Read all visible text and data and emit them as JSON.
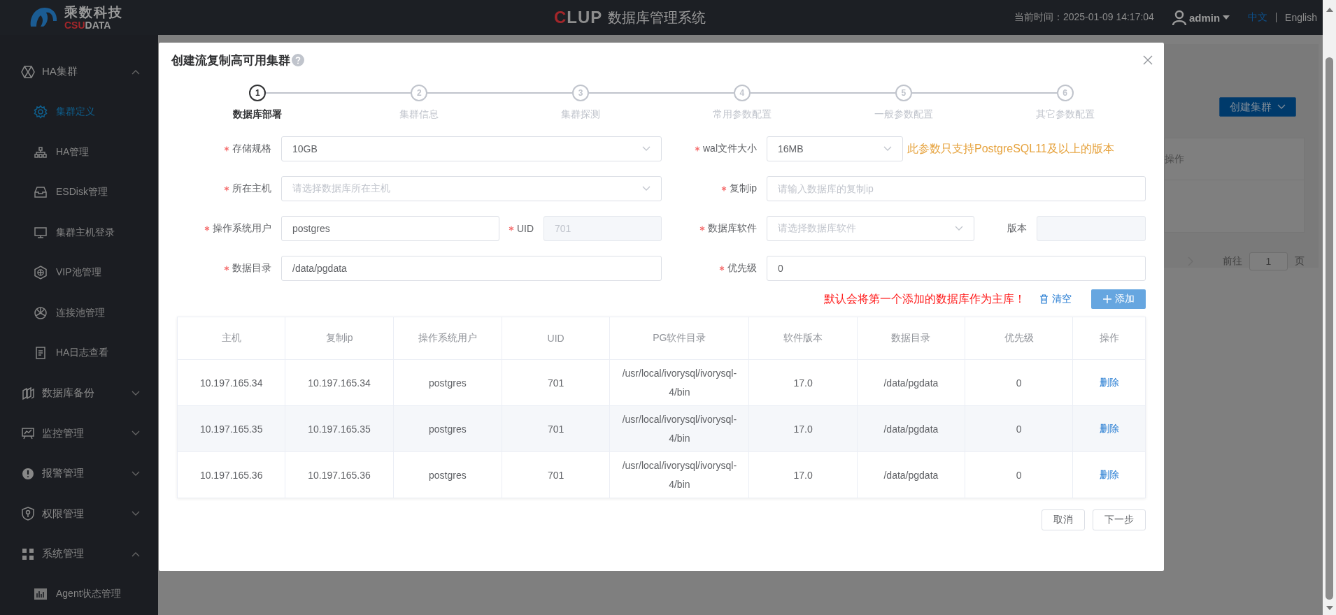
{
  "header": {
    "brand_cn": "乘数科技",
    "brand_mark_a": "CSU",
    "brand_mark_b": "DATA",
    "product_a": "C",
    "product_b": "LUP",
    "title": "数据库管理系统",
    "time": "当前时间：2025-01-09 14:17:04",
    "user": "admin",
    "languages": [
      {
        "label": "中文",
        "selected": true
      },
      {
        "label": "English",
        "selected": false
      }
    ]
  },
  "sidebar": {
    "items": [
      {
        "label": "HA集群",
        "expanded": true,
        "children": [
          {
            "label": "集群定义",
            "selected": true
          },
          {
            "label": "HA管理",
            "selected": false
          },
          {
            "label": "ESDisk管理",
            "selected": false
          },
          {
            "label": "集群主机登录",
            "selected": false
          },
          {
            "label": "VIP池管理",
            "selected": false
          },
          {
            "label": "连接池管理",
            "selected": false
          },
          {
            "label": "HA日志查看",
            "selected": false
          }
        ]
      },
      {
        "label": "数据库备份",
        "expanded": false
      },
      {
        "label": "监控管理",
        "expanded": false
      },
      {
        "label": "报警管理",
        "expanded": false
      },
      {
        "label": "权限管理",
        "expanded": false
      },
      {
        "label": "系统管理",
        "expanded": true,
        "children": [
          {
            "label": "Agent状态管理",
            "selected": false
          }
        ]
      }
    ]
  },
  "background_page": {
    "create_button": "创建集群",
    "table_header": "操作",
    "pagination": {
      "goto": "前往",
      "page": "1",
      "suffix": "页"
    }
  },
  "dialog": {
    "title": "创建流复制高可用集群",
    "steps": [
      {
        "number": "1",
        "label": "数据库部署",
        "selected": true
      },
      {
        "number": "2",
        "label": "集群信息",
        "selected": false
      },
      {
        "number": "3",
        "label": "集群探测",
        "selected": false
      },
      {
        "number": "4",
        "label": "常用参数配置",
        "selected": false
      },
      {
        "number": "5",
        "label": "一般参数配置",
        "selected": false
      },
      {
        "number": "6",
        "label": "其它参数配置",
        "selected": false
      }
    ],
    "form_rows": [
      {
        "left": [
          {
            "label": "存储规格",
            "required": true,
            "kind": "select",
            "value": "10GB"
          }
        ],
        "right": [
          {
            "label": "wal文件大小",
            "required": true,
            "kind": "select",
            "value": "16MB"
          }
        ],
        "note": "此参数只支持PostgreSQL11及以上的版本"
      },
      {
        "left": [
          {
            "label": "所在主机",
            "required": true,
            "kind": "select",
            "placeholder": "请选择数据库所在主机"
          }
        ],
        "right": [
          {
            "label": "复制ip",
            "required": true,
            "kind": "input",
            "placeholder": "请输入数据库的复制ip"
          }
        ]
      },
      {
        "left": [
          {
            "label": "操作系统用户",
            "required": true,
            "kind": "input",
            "value": "postgres"
          },
          {
            "label": "UID",
            "required": true,
            "kind": "input",
            "value": "701",
            "disabled": true
          }
        ],
        "right": [
          {
            "label": "数据库软件",
            "required": true,
            "kind": "select",
            "placeholder": "请选择数据库软件"
          },
          {
            "label": "版本",
            "required": false,
            "kind": "input",
            "disabled": true
          }
        ]
      },
      {
        "left": [
          {
            "label": "数据目录",
            "required": true,
            "kind": "input",
            "value": "/data/pgdata"
          }
        ],
        "right": [
          {
            "label": "优先级",
            "required": true,
            "kind": "input",
            "value": "0"
          }
        ]
      }
    ],
    "warning": "默认会将第一个添加的数据库作为主库！",
    "clear_link": "清空",
    "add_button": "添加",
    "table": {
      "columns": [
        "主机",
        "复制ip",
        "操作系统用户",
        "UID",
        "PG软件目录",
        "软件版本",
        "数据目录",
        "优先级",
        "操作"
      ],
      "rows": [
        {
          "cells": [
            "10.197.165.34",
            "10.197.165.34",
            "postgres",
            "701",
            "/usr/local/ivorysql/ivorysql-4/bin",
            "17.0",
            "/data/pgdata",
            "0"
          ],
          "action": "删除"
        },
        {
          "cells": [
            "10.197.165.35",
            "10.197.165.35",
            "postgres",
            "701",
            "/usr/local/ivorysql/ivorysql-4/bin",
            "17.0",
            "/data/pgdata",
            "0"
          ],
          "action": "删除"
        },
        {
          "cells": [
            "10.197.165.36",
            "10.197.165.36",
            "postgres",
            "701",
            "/usr/local/ivorysql/ivorysql-4/bin",
            "17.0",
            "/data/pgdata",
            "0"
          ],
          "action": "删除"
        }
      ]
    },
    "buttons": [
      "取消",
      "下一步"
    ]
  }
}
